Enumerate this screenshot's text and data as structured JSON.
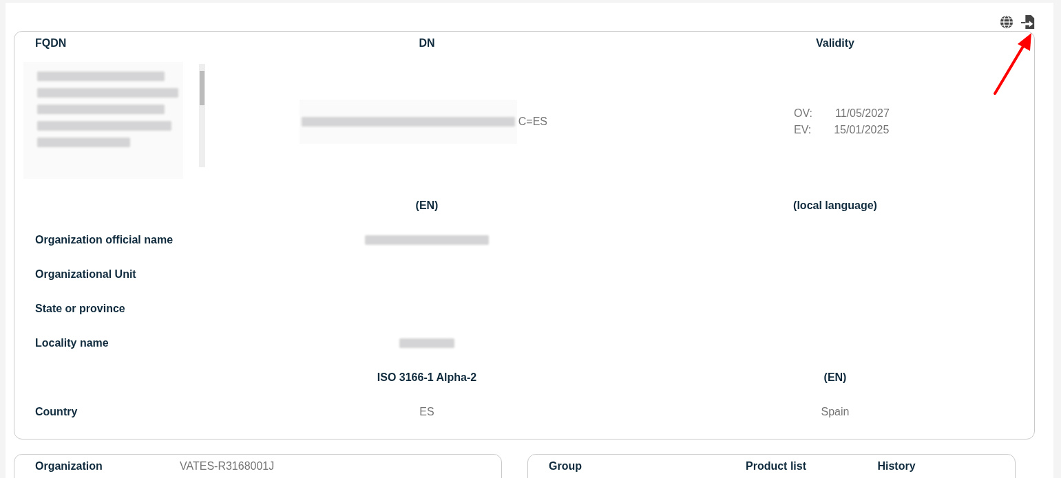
{
  "certificate": {
    "columns": [
      "FQDN",
      "DN",
      "Validity"
    ],
    "fqdn_redacted": true,
    "dn_redacted": true,
    "dn_suffix": "C=ES",
    "validity": [
      {
        "label": "OV:",
        "date": "11/05/2027"
      },
      {
        "label": "EV:",
        "date": "15/01/2025"
      }
    ]
  },
  "name_fields": {
    "columns": [
      "(EN)",
      "(local language)"
    ],
    "rows": [
      {
        "label": "Organization official name",
        "redacted": true
      },
      {
        "label": "Organizational Unit",
        "redacted": false
      },
      {
        "label": "State or province",
        "redacted": false
      },
      {
        "label": "Locality name",
        "redacted": true
      }
    ]
  },
  "country": {
    "columns": [
      "ISO 3166-1 Alpha-2",
      "(EN)"
    ],
    "label": "Country",
    "code": "ES",
    "name": "Spain"
  },
  "organization": {
    "label": "Organization",
    "value": "VATES-R3168001J"
  },
  "group_table": {
    "columns": [
      "Group",
      "Product list",
      "History"
    ]
  }
}
